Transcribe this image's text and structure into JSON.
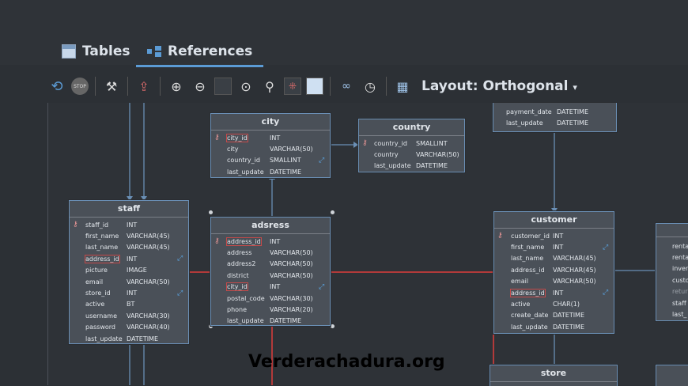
{
  "tabs": [
    {
      "label": "Tables",
      "icon": "table-grid-icon",
      "active": false
    },
    {
      "label": "References",
      "icon": "references-icon",
      "active": true
    }
  ],
  "toolbar": {
    "layout_label": "Layout: Orthogonal",
    "stop_label": "STOP"
  },
  "tables": {
    "city": {
      "name": "city",
      "columns": [
        {
          "name": "city_id",
          "type": "INT"
        },
        {
          "name": "city",
          "type": "VARCHAR(50)"
        },
        {
          "name": "country_id",
          "type": "SMALLINT"
        },
        {
          "name": "last_update",
          "type": "DATETIME"
        }
      ]
    },
    "country": {
      "name": "country",
      "columns": [
        {
          "name": "country_id",
          "type": "SMALLINT"
        },
        {
          "name": "country",
          "type": "VARCHAR(50)"
        },
        {
          "name": "last_update",
          "type": "DATETIME"
        }
      ]
    },
    "payment": {
      "columns": [
        {
          "name": "payment_date",
          "type": "DATETIME"
        },
        {
          "name": "last_update",
          "type": "DATETIME"
        }
      ]
    },
    "staff": {
      "name": "staff",
      "columns": [
        {
          "name": "staff_id",
          "type": "INT"
        },
        {
          "name": "first_name",
          "type": "VARCHAR(45)"
        },
        {
          "name": "last_name",
          "type": "VARCHAR(45)"
        },
        {
          "name": "address_id",
          "type": "INT"
        },
        {
          "name": "picture",
          "type": "IMAGE"
        },
        {
          "name": "email",
          "type": "VARCHAR(50)"
        },
        {
          "name": "store_id",
          "type": "INT"
        },
        {
          "name": "active",
          "type": "BT"
        },
        {
          "name": "username",
          "type": "VARCHAR(30)"
        },
        {
          "name": "password",
          "type": "VARCHAR(40)"
        },
        {
          "name": "last_update",
          "type": "DATETIME"
        }
      ]
    },
    "address": {
      "name": "adsress",
      "columns": [
        {
          "name": "address_id",
          "type": "INT"
        },
        {
          "name": "address",
          "type": "VARCHAR(50)"
        },
        {
          "name": "address2",
          "type": "VARCHAR(50)"
        },
        {
          "name": "district",
          "type": "VARCHAR(50)"
        },
        {
          "name": "city_id",
          "type": "INT"
        },
        {
          "name": "postal_code",
          "type": "VARCHAR(30)"
        },
        {
          "name": "phone",
          "type": "VARCHAR(20)"
        },
        {
          "name": "last_update",
          "type": "DATETIME"
        }
      ]
    },
    "customer": {
      "name": "customer",
      "columns": [
        {
          "name": "customer_id",
          "type": "INT"
        },
        {
          "name": "first_name",
          "type": "INT"
        },
        {
          "name": "last_name",
          "type": "VARCHAR(45)"
        },
        {
          "name": "address_id",
          "type": "VARCHAR(45)"
        },
        {
          "name": "email",
          "type": "VARCHAR(50)"
        },
        {
          "name": "address_id",
          "type": "INT"
        },
        {
          "name": "active",
          "type": "CHAR(1)"
        },
        {
          "name": "create_date",
          "type": "DATETIME"
        },
        {
          "name": "last_update",
          "type": "DATETIME"
        }
      ]
    },
    "store": {
      "name": "store"
    },
    "rental_partial": [
      "renta",
      "renta",
      "inver",
      "custo",
      "retur",
      "staff",
      "last_"
    ]
  },
  "watermark": "Verderachadura.org",
  "colors": {
    "accent": "#5b9bd5",
    "table_bg": "#4a5058",
    "fk_line": "#b23a3a",
    "line": "#6a8fb5"
  }
}
